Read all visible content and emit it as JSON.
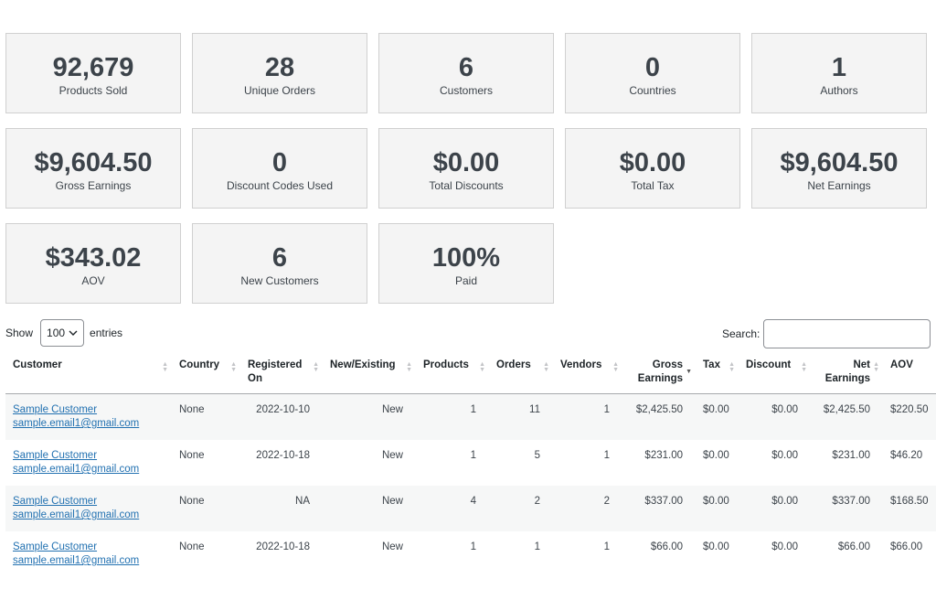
{
  "cards": [
    {
      "value": "92,679",
      "label": "Products Sold"
    },
    {
      "value": "28",
      "label": "Unique Orders"
    },
    {
      "value": "6",
      "label": "Customers"
    },
    {
      "value": "0",
      "label": "Countries"
    },
    {
      "value": "1",
      "label": "Authors"
    },
    {
      "value": "$9,604.50",
      "label": "Gross Earnings"
    },
    {
      "value": "0",
      "label": "Discount Codes Used"
    },
    {
      "value": "$0.00",
      "label": "Total Discounts"
    },
    {
      "value": "$0.00",
      "label": "Total Tax"
    },
    {
      "value": "$9,604.50",
      "label": "Net Earnings"
    },
    {
      "value": "$343.02",
      "label": "AOV"
    },
    {
      "value": "6",
      "label": "New Customers"
    },
    {
      "value": "100%",
      "label": "Paid"
    }
  ],
  "controls": {
    "show_label": "Show",
    "entries_value": "100",
    "entries_label": "entries",
    "search_label": "Search:",
    "search_value": ""
  },
  "table": {
    "headers": [
      "Customer",
      "Country",
      "Registered On",
      "New/Existing",
      "Products",
      "Orders",
      "Vendors",
      "Gross Earnings",
      "Tax",
      "Discount",
      "Net Earnings",
      "AOV"
    ],
    "rows": [
      {
        "name": "Sample Customer",
        "email": "sample.email1@gmail.com",
        "country": "None",
        "registered": "2022-10-10",
        "status": "New",
        "products": "1",
        "orders": "11",
        "vendors": "1",
        "gross": "$2,425.50",
        "tax": "$0.00",
        "discount": "$0.00",
        "net": "$2,425.50",
        "aov": "$220.50"
      },
      {
        "name": "Sample Customer",
        "email": "sample.email1@gmail.com",
        "country": "None",
        "registered": "2022-10-18",
        "status": "New",
        "products": "1",
        "orders": "5",
        "vendors": "1",
        "gross": "$231.00",
        "tax": "$0.00",
        "discount": "$0.00",
        "net": "$231.00",
        "aov": "$46.20"
      },
      {
        "name": "Sample Customer",
        "email": "sample.email1@gmail.com",
        "country": "None",
        "registered": "NA",
        "status": "New",
        "products": "4",
        "orders": "2",
        "vendors": "2",
        "gross": "$337.00",
        "tax": "$0.00",
        "discount": "$0.00",
        "net": "$337.00",
        "aov": "$168.50"
      },
      {
        "name": "Sample Customer",
        "email": "sample.email1@gmail.com",
        "country": "None",
        "registered": "2022-10-18",
        "status": "New",
        "products": "1",
        "orders": "1",
        "vendors": "1",
        "gross": "$66.00",
        "tax": "$0.00",
        "discount": "$0.00",
        "net": "$66.00",
        "aov": "$66.00"
      }
    ]
  }
}
